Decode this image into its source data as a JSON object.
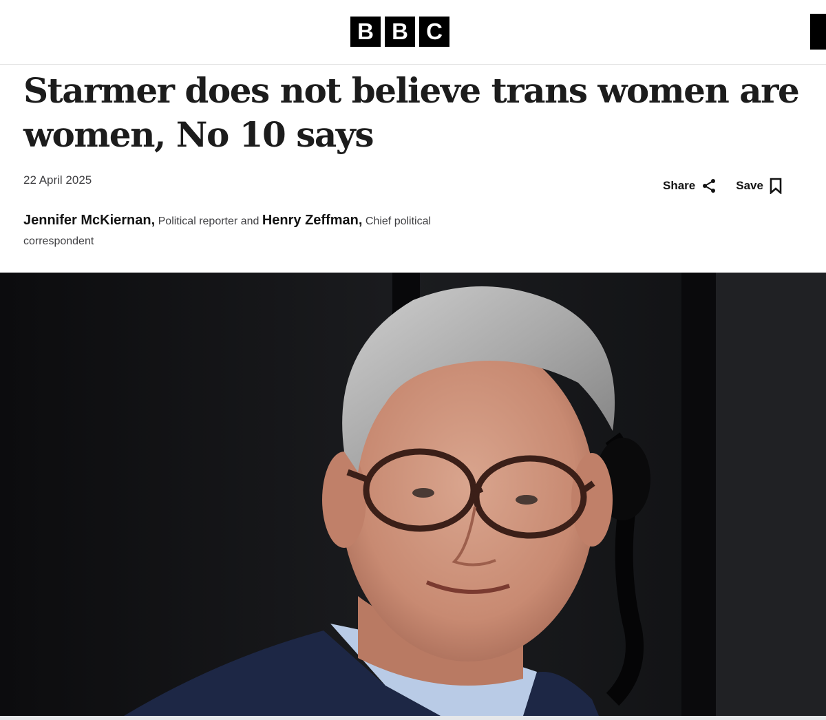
{
  "header": {
    "logo_letters": [
      "B",
      "B",
      "C"
    ]
  },
  "article": {
    "headline": "Starmer does not believe trans women are women, No 10 says",
    "date": "22 April 2025",
    "share_label": "Share",
    "save_label": "Save",
    "authors": [
      {
        "name": "Jennifer McKiernan,",
        "role": "Political reporter"
      },
      {
        "name": "Henry Zeffman,",
        "role": "Chief political correspondent"
      }
    ],
    "byline_joiner": "and"
  },
  "icons": {
    "share": "share-icon",
    "save": "bookmark-icon"
  },
  "colors": {
    "brand": "#000000",
    "text": "#141414",
    "meta": "#3f3f42"
  }
}
